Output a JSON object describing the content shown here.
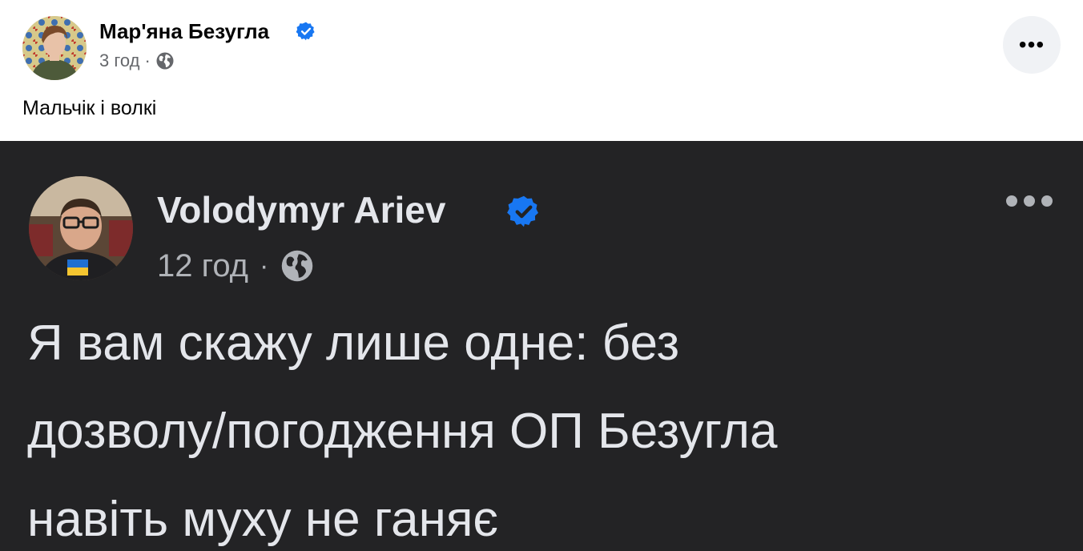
{
  "post": {
    "author": "Мар'яна Безугла",
    "verified": true,
    "time": "3 год",
    "separator": "·",
    "audience_icon": "globe-icon",
    "more_label": "•••",
    "text": "Мальчік і волкі"
  },
  "embedded_post": {
    "author": "Volodymyr Ariev",
    "verified": true,
    "time": "12 год",
    "separator": "·",
    "audience_icon": "globe-icon",
    "more_icon": "more-options-icon",
    "lines": [
      "Я вам скажу лише одне: без",
      "дозволу/погодження ОП Безугла",
      "навіть муху не ганяє"
    ]
  },
  "colors": {
    "verified_blue": "#1877f2",
    "dark_bg": "#232325",
    "light_bg": "#ffffff",
    "secondary_text": "#65676b"
  }
}
